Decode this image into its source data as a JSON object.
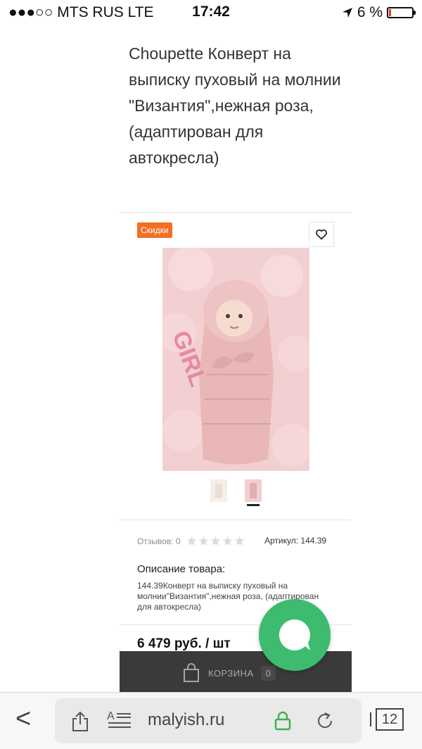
{
  "status_bar": {
    "carrier": "●●●○○ MTS RUS  LTE",
    "time": "17:42",
    "battery": "6 %",
    "battery_level": 0.06
  },
  "product": {
    "title": "Choupette Конверт на выписку пуховый на молнии \"Византия\",нежная роза, (адаптирован для автокресла)",
    "badge": "Скидки",
    "reviews_label": "Отзывов: 0",
    "rating": 0,
    "article": "Артикул: 144.39",
    "description_heading": "Описание товара:",
    "description_text": "144.39Конверт на выписку пуховый на молнии\"Византия\",нежная роза, (адаптирован для автокресла)",
    "price": "6 479 руб. / шт"
  },
  "cart": {
    "label": "КОРЗИНА",
    "count": "0"
  },
  "browser": {
    "url": "malyish.ru",
    "tabs": "12"
  },
  "icons": {
    "favorite": "heart-icon",
    "chat": "chat-bubble-icon",
    "cart": "shopping-bag-icon",
    "share": "share-icon",
    "reader": "reader-icon",
    "lock": "lock-icon",
    "reload": "reload-icon",
    "location": "location-arrow-icon"
  },
  "colors": {
    "badge": "#f36f21",
    "chat": "#3dbb6e",
    "cart_bar": "#3a3a3a",
    "lock": "#3fb34f"
  }
}
